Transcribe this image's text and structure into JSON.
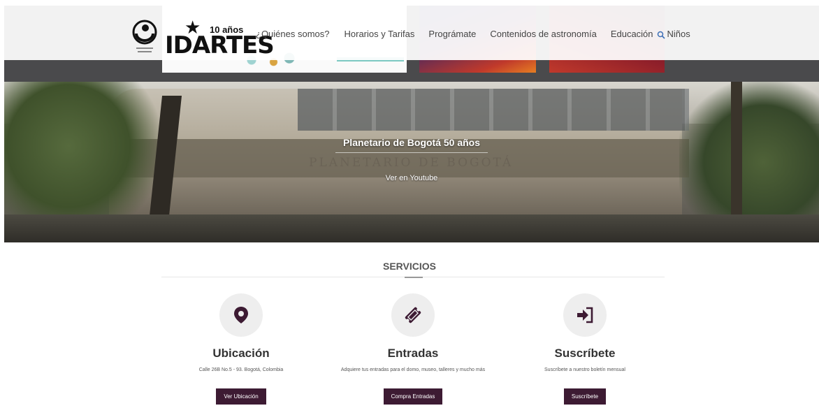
{
  "header": {
    "logo_tenanos": "10 años",
    "logo_word": "IDARTES",
    "nav": [
      "¿Quiénes somos?",
      "Horarios y Tarifas",
      "Prográmate",
      "Contenidos de astronomía",
      "Educación",
      "Niños"
    ]
  },
  "hero": {
    "title": "Planetario de Bogotá 50 años",
    "link": "Ver en Youtube",
    "sign": "PLANETARIO DE BOGOTÁ"
  },
  "services": {
    "title": "SERVICIOS",
    "cards": [
      {
        "icon": "map-marker-icon",
        "title": "Ubicación",
        "text": "Calle 26B No.5 - 93. Bogotá, Colombia",
        "button": "Ver Ubicación"
      },
      {
        "icon": "ticket-icon",
        "title": "Entradas",
        "text": "Adquiere tus entradas para el domo, museo, talleres y mucho más",
        "button": "Compra Entradas"
      },
      {
        "icon": "sign-in-icon",
        "title": "Suscríbete",
        "text": "Suscríbete a nuestro boletín mensual",
        "button": "Suscríbete"
      }
    ]
  },
  "colors": {
    "button": "#3d1b33",
    "icon": "#3d1b33",
    "search": "#3b6fb6"
  }
}
